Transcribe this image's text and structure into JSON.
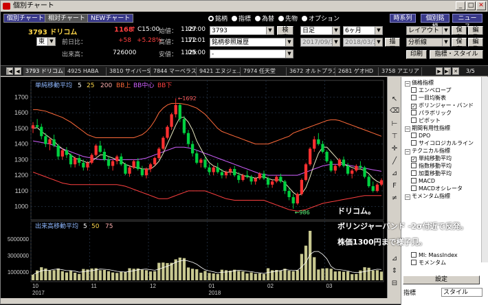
{
  "window": {
    "title": "個別チャート"
  },
  "tabs": {
    "individual": "個別チャート",
    "relative": "相対チャート",
    "new": "NEWチャート"
  },
  "stock": {
    "code_name": "3793 ドリコム",
    "price": "1168",
    "price_flag": "↑",
    "time": "C15:00",
    "change_label": "前日比：",
    "change": "+58",
    "change_pct": "+5.28%",
    "volume_label": "出来高：",
    "volume": "726000",
    "open_label": "始値：",
    "open": "1127",
    "open_time": "09:00",
    "high_label": "高値：",
    "high": "1172",
    "high_time": "11:01",
    "low_label": "安値：",
    "low": "1125",
    "low_time": "09:00",
    "market": "東"
  },
  "search": {
    "types": [
      "銘柄",
      "指標",
      "為替",
      "先物",
      "オプション"
    ],
    "selected_type": "銘柄",
    "code_value": "3793",
    "search_button": "検索",
    "history_value": "銘柄参照履歴",
    "third_value": "-"
  },
  "period": {
    "interval": "日足",
    "range": "6ヶ月",
    "from": "2017/09/30",
    "to": "2018/03/31",
    "draw_button": "描画"
  },
  "rightbuttons": {
    "timeseries": "時系列",
    "individual_issue": "個別銘柄",
    "news": "ニュース",
    "layout": "レイアウト",
    "save1": "保存",
    "edit1": "編集",
    "analysis": "分析線",
    "save2": "保存",
    "edit2": "編集",
    "print": "印刷",
    "indicator_style": "指標・スタイル>>"
  },
  "stocktabs": [
    "3793 ドリコム",
    "4925 HABA",
    "3810 サイバーS",
    "7844 マーベラス",
    "9421 エヌジェ..",
    "7974 任天堂",
    "3672 オルトプラス",
    "2681 ゲオHD",
    "3758 アエリア"
  ],
  "stocktab_page": "3/5",
  "chart": {
    "legend": {
      "name": "単純移動平均",
      "p1": "5",
      "p2": "25",
      "p3": "200",
      "bb_up": "BB上",
      "bb_mid": "BB中心",
      "bb_low": "BB下"
    },
    "yticks": [
      "1700",
      "1600",
      "1500",
      "1400",
      "1300",
      "1200",
      "1100",
      "1000"
    ],
    "high_mark": "←1692",
    "low_mark": "←986",
    "vol_legend": {
      "name": "出来高移動平均",
      "p1": "5",
      "p2": "50",
      "p3": "75"
    },
    "vol_ticks": [
      "5000000",
      "3000000",
      "1000000"
    ],
    "xticks": [
      "10",
      "11",
      "12",
      "01",
      "02",
      "03"
    ],
    "years": [
      "2017",
      "2018"
    ]
  },
  "chart_data": {
    "type": "candlestick",
    "ylim": [
      950,
      1750
    ],
    "ohlc": [
      [
        1500,
        1540,
        1470,
        1520
      ],
      [
        1520,
        1560,
        1500,
        1510
      ],
      [
        1510,
        1530,
        1430,
        1450
      ],
      [
        1450,
        1470,
        1380,
        1400
      ],
      [
        1400,
        1440,
        1360,
        1430
      ],
      [
        1430,
        1460,
        1380,
        1390
      ],
      [
        1390,
        1400,
        1300,
        1320
      ],
      [
        1320,
        1370,
        1300,
        1360
      ],
      [
        1360,
        1380,
        1310,
        1330
      ],
      [
        1330,
        1340,
        1250,
        1270
      ],
      [
        1270,
        1320,
        1250,
        1310
      ],
      [
        1310,
        1330,
        1260,
        1280
      ],
      [
        1280,
        1300,
        1230,
        1250
      ],
      [
        1250,
        1290,
        1230,
        1280
      ],
      [
        1280,
        1340,
        1270,
        1330
      ],
      [
        1330,
        1400,
        1320,
        1390
      ],
      [
        1390,
        1420,
        1340,
        1350
      ],
      [
        1350,
        1370,
        1290,
        1300
      ],
      [
        1300,
        1320,
        1240,
        1260
      ],
      [
        1260,
        1300,
        1230,
        1290
      ],
      [
        1290,
        1330,
        1270,
        1320
      ],
      [
        1320,
        1340,
        1260,
        1270
      ],
      [
        1270,
        1280,
        1200,
        1210
      ],
      [
        1210,
        1260,
        1190,
        1250
      ],
      [
        1250,
        1300,
        1240,
        1290
      ],
      [
        1290,
        1310,
        1230,
        1240
      ],
      [
        1240,
        1260,
        1190,
        1200
      ],
      [
        1200,
        1250,
        1180,
        1240
      ],
      [
        1240,
        1280,
        1220,
        1270
      ],
      [
        1270,
        1320,
        1260,
        1310
      ],
      [
        1310,
        1380,
        1300,
        1370
      ],
      [
        1370,
        1450,
        1360,
        1440
      ],
      [
        1440,
        1520,
        1430,
        1510
      ],
      [
        1510,
        1600,
        1490,
        1590
      ],
      [
        1590,
        1692,
        1570,
        1650
      ],
      [
        1650,
        1660,
        1540,
        1560
      ],
      [
        1560,
        1580,
        1460,
        1470
      ],
      [
        1470,
        1490,
        1380,
        1400
      ],
      [
        1400,
        1420,
        1320,
        1340
      ],
      [
        1340,
        1360,
        1270,
        1280
      ],
      [
        1280,
        1310,
        1250,
        1300
      ],
      [
        1300,
        1320,
        1240,
        1250
      ],
      [
        1250,
        1270,
        1200,
        1220
      ],
      [
        1220,
        1260,
        1200,
        1250
      ],
      [
        1250,
        1280,
        1210,
        1220
      ],
      [
        1220,
        1240,
        1180,
        1200
      ],
      [
        1200,
        1230,
        1180,
        1220
      ],
      [
        1220,
        1250,
        1200,
        1240
      ],
      [
        1240,
        1260,
        1190,
        1200
      ],
      [
        1200,
        1220,
        1150,
        1170
      ],
      [
        1170,
        1210,
        1160,
        1200
      ],
      [
        1200,
        1230,
        1180,
        1190
      ],
      [
        1190,
        1200,
        1140,
        1160
      ],
      [
        1160,
        1190,
        1140,
        1180
      ],
      [
        1180,
        1220,
        1170,
        1210
      ],
      [
        1210,
        1230,
        1170,
        1180
      ],
      [
        1180,
        1190,
        1120,
        1140
      ],
      [
        1140,
        1170,
        1120,
        1160
      ],
      [
        1160,
        1200,
        1150,
        1190
      ],
      [
        1190,
        1210,
        1150,
        1160
      ],
      [
        1160,
        1170,
        1080,
        1100
      ],
      [
        1100,
        1120,
        1040,
        1060
      ],
      [
        1060,
        1080,
        986,
        1020
      ],
      [
        1020,
        1090,
        1010,
        1080
      ],
      [
        1080,
        1180,
        1070,
        1170
      ],
      [
        1170,
        1280,
        1160,
        1270
      ],
      [
        1270,
        1380,
        1260,
        1370
      ],
      [
        1370,
        1450,
        1350,
        1430
      ],
      [
        1430,
        1470,
        1390,
        1400
      ],
      [
        1400,
        1420,
        1340,
        1350
      ],
      [
        1350,
        1360,
        1280,
        1290
      ],
      [
        1290,
        1300,
        1220,
        1230
      ],
      [
        1230,
        1270,
        1210,
        1260
      ],
      [
        1260,
        1310,
        1250,
        1300
      ],
      [
        1300,
        1320,
        1250,
        1260
      ],
      [
        1260,
        1280,
        1200,
        1210
      ],
      [
        1210,
        1240,
        1180,
        1230
      ],
      [
        1230,
        1270,
        1220,
        1260
      ],
      [
        1260,
        1290,
        1240,
        1250
      ],
      [
        1250,
        1260,
        1180,
        1190
      ],
      [
        1190,
        1200,
        1120,
        1130
      ],
      [
        1130,
        1160,
        1090,
        1100
      ],
      [
        1100,
        1150,
        1090,
        1140
      ],
      [
        1140,
        1180,
        1130,
        1168
      ]
    ],
    "sma5": [
      1500,
      1505,
      1480,
      1460,
      1440,
      1420,
      1390,
      1370,
      1350,
      1330,
      1310,
      1300,
      1290,
      1280,
      1290,
      1310,
      1330,
      1330,
      1320,
      1310,
      1300,
      1290,
      1270,
      1260,
      1250,
      1250,
      1240,
      1240,
      1240,
      1260,
      1290,
      1340,
      1400,
      1460,
      1520,
      1570,
      1570,
      1540,
      1490,
      1420,
      1370,
      1320,
      1280,
      1260,
      1250,
      1230,
      1220,
      1220,
      1220,
      1210,
      1200,
      1190,
      1190,
      1180,
      1190,
      1190,
      1180,
      1170,
      1170,
      1170,
      1150,
      1120,
      1090,
      1070,
      1080,
      1120,
      1190,
      1270,
      1340,
      1380,
      1380,
      1350,
      1320,
      1290,
      1270,
      1260,
      1250,
      1240,
      1240,
      1230,
      1210,
      1180,
      1160,
      1150
    ],
    "bb_upper": [
      1620,
      1620,
      1615,
      1610,
      1600,
      1590,
      1580,
      1570,
      1555,
      1540,
      1520,
      1500,
      1480,
      1460,
      1450,
      1440,
      1440,
      1440,
      1440,
      1440,
      1440,
      1440,
      1440,
      1440,
      1440,
      1450,
      1460,
      1480,
      1510,
      1550,
      1600,
      1630,
      1650,
      1660,
      1660,
      1660,
      1655,
      1650,
      1640,
      1630,
      1610,
      1590,
      1560,
      1530,
      1500,
      1480,
      1470,
      1460,
      1450,
      1440,
      1430,
      1420,
      1410,
      1400,
      1400,
      1400,
      1400,
      1410,
      1420,
      1430,
      1440,
      1450,
      1470,
      1480,
      1490,
      1500,
      1510,
      1520,
      1530,
      1540,
      1550,
      1555,
      1555,
      1550,
      1540,
      1530,
      1520,
      1510,
      1500,
      1490,
      1480,
      1470,
      1460,
      1450
    ],
    "bb_middle": [
      1420,
      1415,
      1410,
      1405,
      1400,
      1390,
      1380,
      1370,
      1360,
      1350,
      1340,
      1330,
      1320,
      1315,
      1310,
      1305,
      1300,
      1300,
      1300,
      1300,
      1300,
      1300,
      1300,
      1300,
      1300,
      1300,
      1305,
      1310,
      1320,
      1330,
      1340,
      1350,
      1360,
      1370,
      1380,
      1380,
      1380,
      1375,
      1370,
      1360,
      1350,
      1340,
      1330,
      1320,
      1310,
      1300,
      1290,
      1280,
      1270,
      1260,
      1250,
      1240,
      1230,
      1220,
      1210,
      1205,
      1200,
      1200,
      1200,
      1200,
      1200,
      1200,
      1200,
      1200,
      1210,
      1220,
      1230,
      1240,
      1250,
      1260,
      1265,
      1270,
      1270,
      1270,
      1270,
      1265,
      1260,
      1255,
      1250,
      1245,
      1240,
      1235,
      1230,
      1225
    ],
    "bb_lower": [
      1220,
      1210,
      1200,
      1190,
      1180,
      1170,
      1160,
      1150,
      1145,
      1140,
      1140,
      1140,
      1140,
      1140,
      1140,
      1140,
      1140,
      1140,
      1140,
      1140,
      1140,
      1135,
      1130,
      1120,
      1110,
      1100,
      1090,
      1080,
      1070,
      1060,
      1050,
      1050,
      1050,
      1060,
      1070,
      1080,
      1090,
      1100,
      1100,
      1100,
      1100,
      1100,
      1090,
      1080,
      1070,
      1060,
      1050,
      1045,
      1040,
      1040,
      1040,
      1040,
      1040,
      1040,
      1040,
      1040,
      1030,
      1020,
      1010,
      1000,
      990,
      980,
      975,
      970,
      975,
      980,
      990,
      1000,
      1010,
      1020,
      1025,
      1030,
      1035,
      1040,
      1045,
      1050,
      1055,
      1060,
      1065,
      1070,
      1070,
      1070,
      1070,
      1070
    ]
  },
  "panel": {
    "groups": [
      {
        "label": "価格指標",
        "items": [
          {
            "label": "エンベロープ",
            "on": false
          },
          {
            "label": "一目均衡表",
            "on": false
          },
          {
            "label": "ボリンジャー・バンド",
            "on": true
          },
          {
            "label": "パラボリック",
            "on": false
          },
          {
            "label": "ピボット",
            "on": false
          }
        ]
      },
      {
        "label": "期間有用性指標",
        "items": [
          {
            "label": "DPO",
            "on": false
          },
          {
            "label": "サイコロジカルライン",
            "on": false
          }
        ]
      },
      {
        "label": "テクニカル指標",
        "items": [
          {
            "label": "単純移動平均",
            "on": true
          },
          {
            "label": "指数移動平均",
            "on": false
          },
          {
            "label": "加重移動平均",
            "on": false
          },
          {
            "label": "MACD",
            "on": false
          },
          {
            "label": "MACDオシレータ",
            "on": false
          }
        ]
      },
      {
        "label": "モメンタム指標",
        "items": []
      }
    ],
    "lower_items": [
      {
        "label": "MI: MassIndex",
        "on": false
      },
      {
        "label": "モメンタム",
        "on": false
      }
    ],
    "settings_button": "設定",
    "indicator_label": "指標",
    "style_label": "スタイル"
  },
  "overlay": {
    "line1": "ドリコム。",
    "line2": "ボリンジャーバンド -2σ付近で反発。",
    "line3": "株価1300円まで様子見。"
  },
  "colors": {
    "up": "#ff3030",
    "down": "#00d040",
    "sma5": "#ffffff",
    "bb": "#ff6a3a",
    "bb_mid": "#d060ff",
    "panel_bg": "#ffffff"
  }
}
